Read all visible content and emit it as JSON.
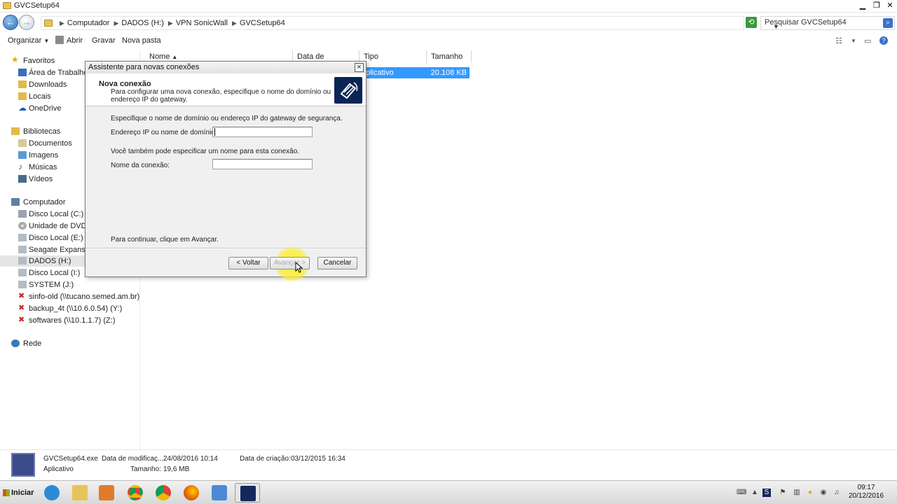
{
  "window": {
    "title": "GVCSetup64"
  },
  "address": {
    "crumbs": [
      "Computador",
      "DADOS (H:)",
      "VPN SonicWall",
      "GVCSetup64"
    ],
    "search_placeholder": "Pesquisar GVCSetup64"
  },
  "toolbar": {
    "organize": "Organizar",
    "open": "Abrir",
    "burn": "Gravar",
    "new_folder": "Nova pasta"
  },
  "columns": {
    "name": "Nome",
    "date": "Data de modificaç...",
    "type": "Tipo",
    "size": "Tamanho"
  },
  "file": {
    "type": "plicativo",
    "size": "20.108 KB"
  },
  "sidebar": {
    "favorites": "Favoritos",
    "desktop": "Área de Trabalho",
    "downloads": "Downloads",
    "locais": "Locais",
    "onedrive": "OneDrive",
    "libraries": "Bibliotecas",
    "documents": "Documentos",
    "images": "Imagens",
    "music": "Músicas",
    "videos": "Vídeos",
    "computer": "Computador",
    "drive_c": "Disco Local (C:)",
    "drive_dvd": "Unidade de DVD-R\\",
    "drive_e": "Disco Local (E:)",
    "seagate": "Seagate Expansion",
    "drive_h": "DADOS (H:)",
    "drive_i": "Disco Local (I:)",
    "drive_j": "SYSTEM (J:)",
    "net_x": "sinfo-old (\\\\tucano.semed.am.br) (X:",
    "net_y": "backup_4t (\\\\10.6.0.54) (Y:)",
    "net_z": "softwares (\\\\10.1.1.7) (Z:)",
    "network": "Rede"
  },
  "dialog": {
    "title": "Assistente para novas conexões",
    "close": "×",
    "header_title": "Nova conexão",
    "header_desc": "Para configurar uma nova conexão, especifique o nome do domínio ou endereço IP do gateway.",
    "gateway_prompt": "Especifique o nome de domínio ou endereço IP do gateway de segurança.",
    "ip_label": "Endereço IP ou nome de domínio:",
    "ip_value": "",
    "name_prompt": "Você também pode especificar um nome para esta conexão.",
    "name_label": "Nome da conexão:",
    "name_value": "",
    "continue_hint": "Para continuar, clique em Avançar.",
    "back_button": "< Voltar",
    "next_button": "Avançar >",
    "cancel_button": "Cancelar"
  },
  "details": {
    "filename": "GVCSetup64.exe",
    "type": "Aplicativo",
    "modified_label": "Data de modificaç...",
    "modified_value": "24/08/2016 10:14",
    "size_label": "Tamanho:",
    "size_value": "19,6 MB",
    "created_label": "Data de criação:",
    "created_value": "03/12/2015 16:34"
  },
  "taskbar": {
    "start": "Iniciar",
    "time": "09:17",
    "date": "20/12/2016",
    "apps": [
      "internet-explorer",
      "file-explorer",
      "media-player",
      "chrome",
      "chrome-alt",
      "firefox",
      "control-panel",
      "sonicwall"
    ]
  }
}
